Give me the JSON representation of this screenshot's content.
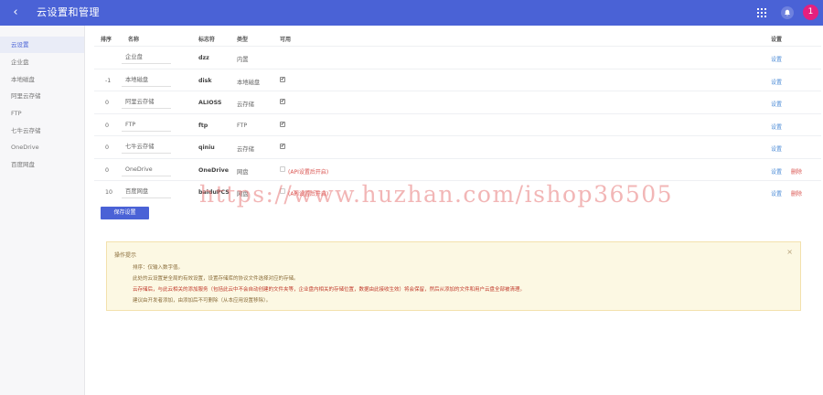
{
  "header": {
    "back_glyph": "‹",
    "title": "云设置和管理",
    "avatar_count": "1",
    "bg_color": "#4a62d6"
  },
  "sidebar": {
    "items": [
      {
        "label": "云设置",
        "active": true
      },
      {
        "label": "企业盘",
        "active": false
      },
      {
        "label": "本地磁盘",
        "active": false
      },
      {
        "label": "阿里云存储",
        "active": false
      },
      {
        "label": "FTP",
        "active": false
      },
      {
        "label": "七牛云存储",
        "active": false
      },
      {
        "label": "OneDrive",
        "active": false
      },
      {
        "label": "百度网盘",
        "active": false
      }
    ]
  },
  "table": {
    "headers": {
      "order": "排序",
      "name": "名称",
      "mark": "标志符",
      "type": "类型",
      "available": "可用",
      "settings": "设置"
    },
    "rows": [
      {
        "order": "",
        "name": "企业盘",
        "mark": "dzz",
        "type": "内置",
        "available": "none",
        "warn": "",
        "settings": "设置",
        "delete": ""
      },
      {
        "order": "-1",
        "name": "本地磁盘",
        "mark": "disk",
        "type": "本地磁盘",
        "available": "checked",
        "warn": "",
        "settings": "设置",
        "delete": ""
      },
      {
        "order": "0",
        "name": "阿里云存储",
        "mark": "ALIOSS",
        "type": "云存储",
        "available": "checked",
        "warn": "",
        "settings": "设置",
        "delete": ""
      },
      {
        "order": "0",
        "name": "FTP",
        "mark": "ftp",
        "type": "FTP",
        "available": "checked",
        "warn": "",
        "settings": "设置",
        "delete": ""
      },
      {
        "order": "0",
        "name": "七牛云存储",
        "mark": "qiniu",
        "type": "云存储",
        "available": "checked",
        "warn": "",
        "settings": "设置",
        "delete": ""
      },
      {
        "order": "0",
        "name": "OneDrive",
        "mark": "OneDrive",
        "type": "网盘",
        "available": "disabled",
        "warn": "(API设置后开启)",
        "settings": "设置",
        "delete": "删除"
      },
      {
        "order": "10",
        "name": "百度网盘",
        "mark": "baiduPCS",
        "type": "网盘",
        "available": "disabled",
        "warn": "(API设置后开启)",
        "settings": "设置",
        "delete": "删除"
      }
    ]
  },
  "save_button": "保存设置",
  "tip": {
    "title": "操作提示",
    "close": "×",
    "lines": [
      {
        "text": "排序：仅输入数字值。",
        "red": false
      },
      {
        "text": "此处的云设置是全局的有效设置，设置存储库的协议文件选择对应的存储。",
        "red": false
      },
      {
        "text": "云存储后，与此云相关的添加服务（包括此云中不会自动创建的文件夹等，企业盘内相关的存储位置，数据由此接收生效）将会保留，然后从添加的文件和用户云盘全部被清理。",
        "red": true
      },
      {
        "text": "建议由开发者添加，由添加后不可删除（从本应用设置移除）。",
        "red": false
      }
    ]
  },
  "watermark": "https://www.huzhan.com/ishop36505"
}
